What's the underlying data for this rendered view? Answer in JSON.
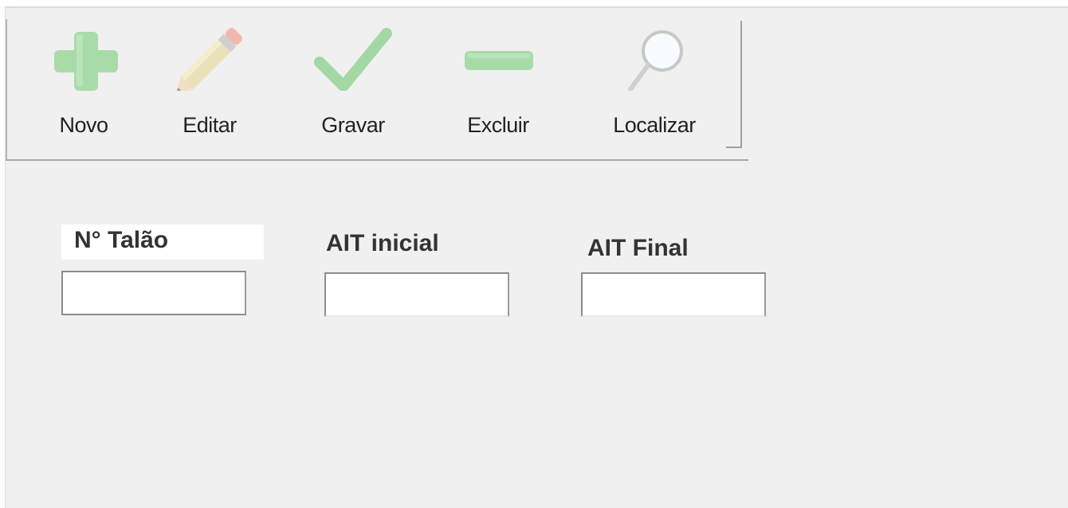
{
  "toolbar": {
    "buttons": [
      {
        "id": "novo",
        "label": "Novo",
        "icon": "plus-icon"
      },
      {
        "id": "editar",
        "label": "Editar",
        "icon": "pencil-icon"
      },
      {
        "id": "gravar",
        "label": "Gravar",
        "icon": "checkmark-icon"
      },
      {
        "id": "excluir",
        "label": "Excluir",
        "icon": "minus-icon"
      },
      {
        "id": "localizar",
        "label": "Localizar",
        "icon": "magnifier-icon"
      }
    ]
  },
  "form": {
    "talao": {
      "label": "N° Talão",
      "value": ""
    },
    "ait_inicial": {
      "label": "AIT inicial",
      "value": ""
    },
    "ait_final": {
      "label": "AIT Final",
      "value": ""
    }
  },
  "colors": {
    "background": "#f0f0f0",
    "icon_green": "#a8dca8",
    "icon_gray": "#d8d8d8"
  }
}
